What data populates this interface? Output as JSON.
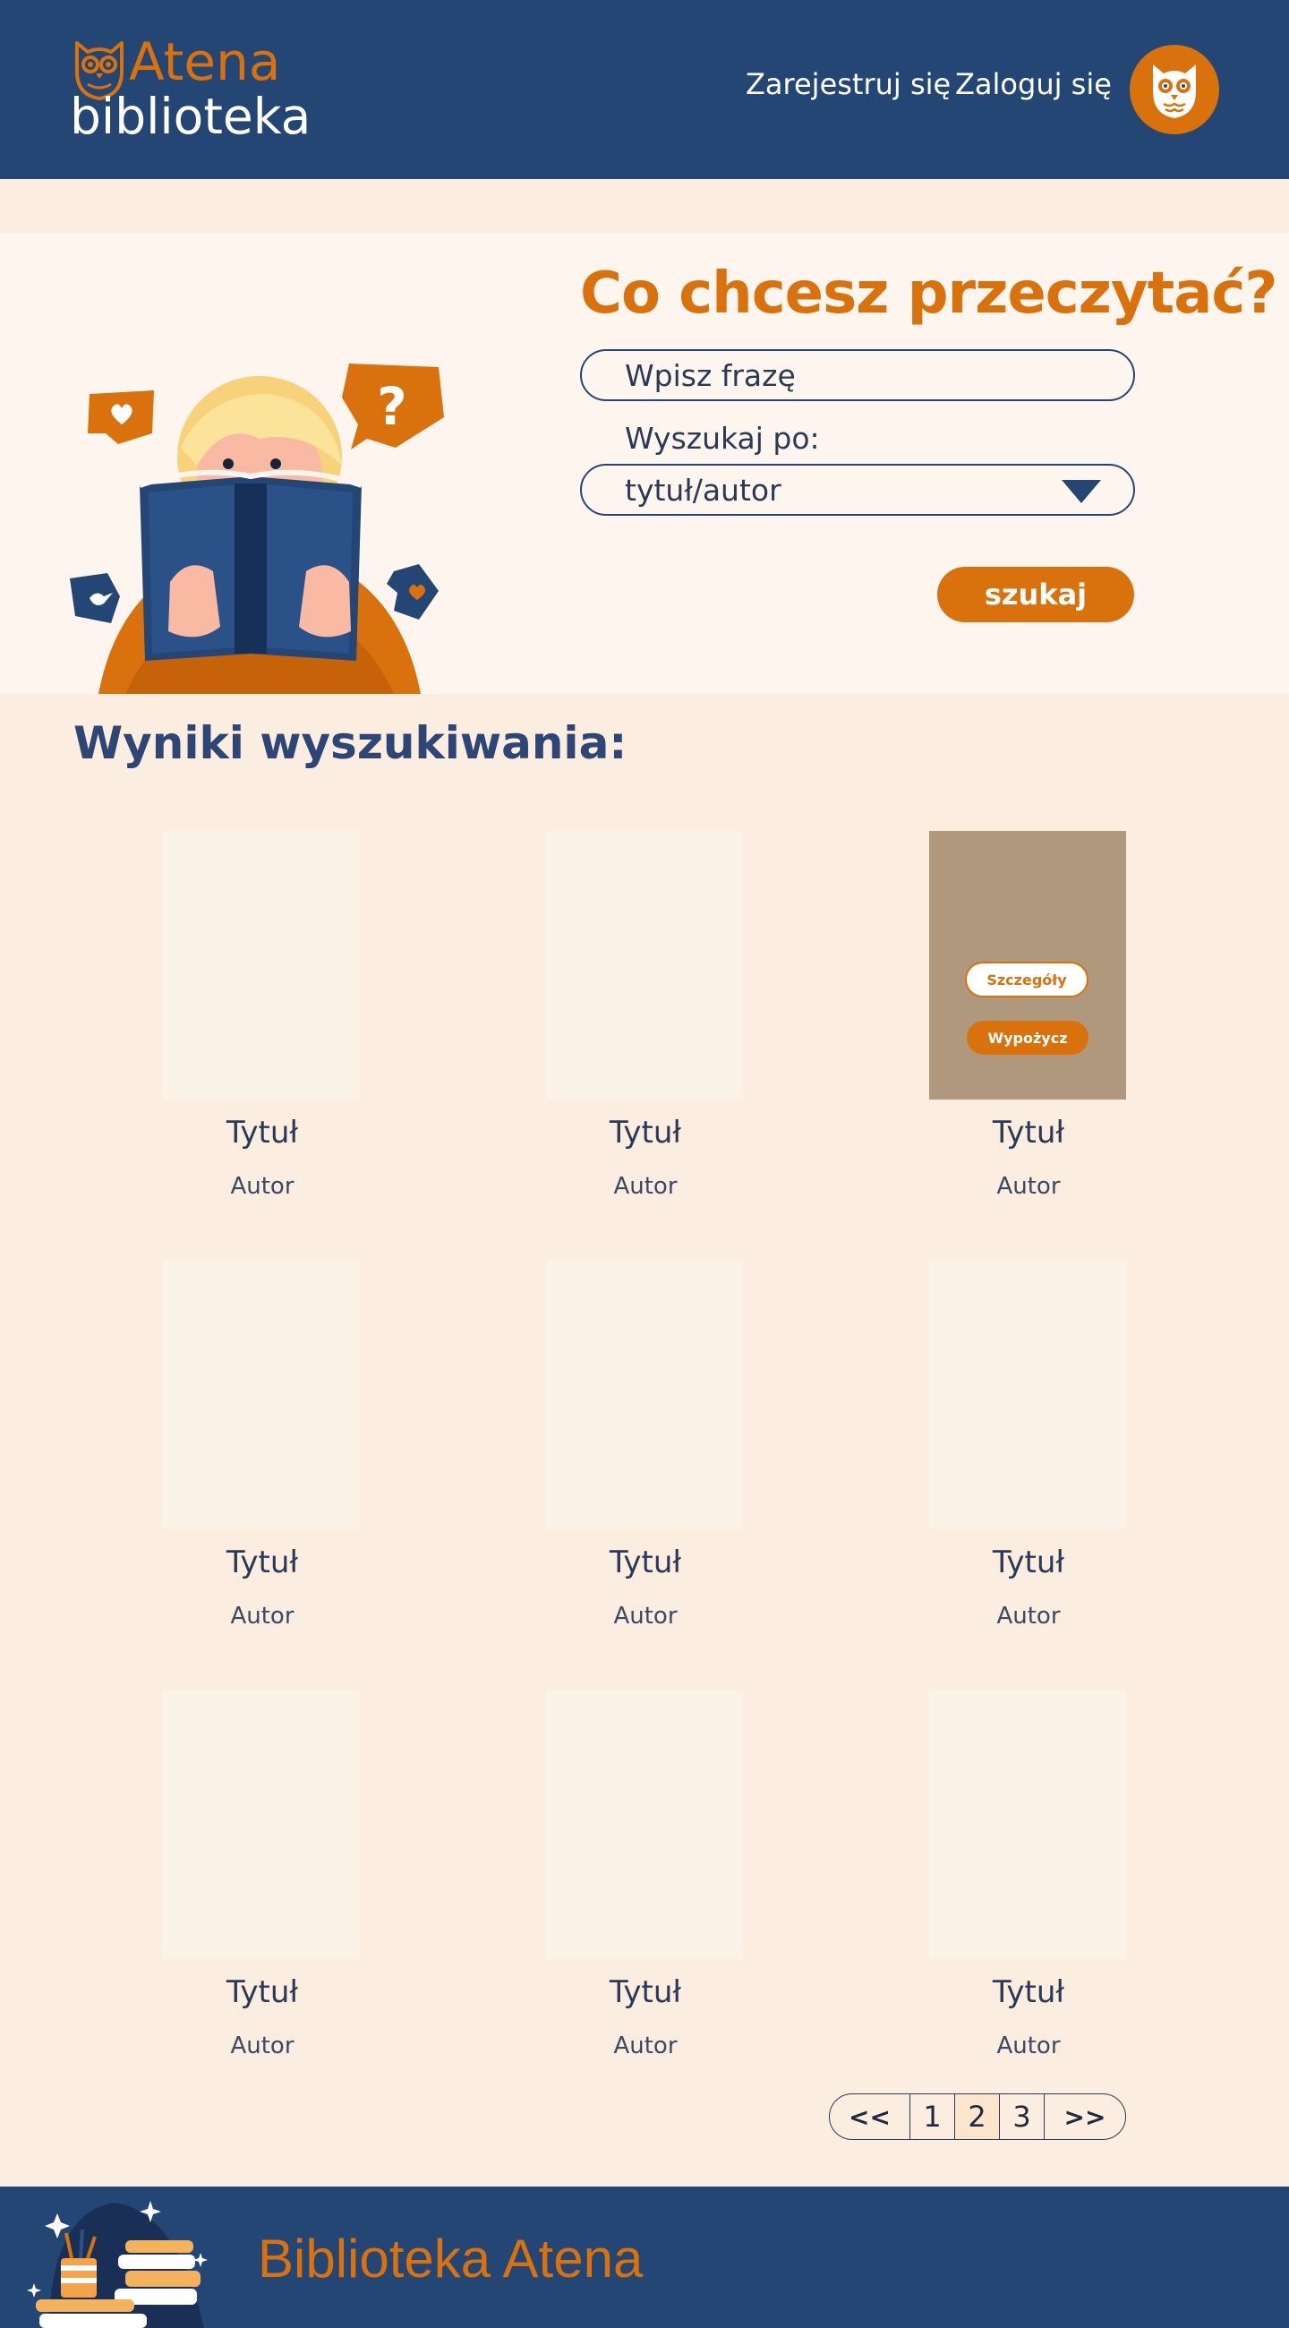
{
  "header": {
    "logo_top": "Atena",
    "logo_bottom": "biblioteka",
    "nav": {
      "register": "Zarejestruj się",
      "login": "Zaloguj się"
    }
  },
  "search": {
    "heading": "Co chcesz przeczytać?",
    "input_placeholder": "Wpisz frazę",
    "search_by_label": "Wyszukaj po:",
    "search_by_value": "tytuł/autor",
    "button": "szukaj"
  },
  "results": {
    "heading": "Wyniki wyszukiwania:",
    "books": [
      {
        "title": "Tytuł",
        "author": "Autor"
      },
      {
        "title": "Tytuł",
        "author": "Autor"
      },
      {
        "title": "Tytuł",
        "author": "Autor"
      },
      {
        "title": "Tytuł",
        "author": "Autor"
      },
      {
        "title": "Tytuł",
        "author": "Autor"
      },
      {
        "title": "Tytuł",
        "author": "Autor"
      },
      {
        "title": "Tytuł",
        "author": "Autor"
      },
      {
        "title": "Tytuł",
        "author": "Autor"
      },
      {
        "title": "Tytuł",
        "author": "Autor"
      }
    ],
    "hover_actions": {
      "details": "Szczegóły",
      "borrow": "Wypożycz"
    }
  },
  "pagination": {
    "prev": "<<",
    "pages": [
      "1",
      "2",
      "3"
    ],
    "current": "2",
    "next": ">>"
  },
  "footer": {
    "title": "Biblioteka Atena"
  },
  "colors": {
    "navy": "#244675",
    "orange": "#d9720d",
    "page_bg": "#fbeddf",
    "hero_bg": "#fef6ee",
    "cover_placeholder": "#fbf2e8",
    "cover_hover": "#af987c"
  },
  "icons": [
    "owl-logo-icon",
    "owl-avatar-icon",
    "dropdown-triangle-icon",
    "heart-bubble-icon",
    "question-bubble-icon",
    "books-stack-icon"
  ]
}
